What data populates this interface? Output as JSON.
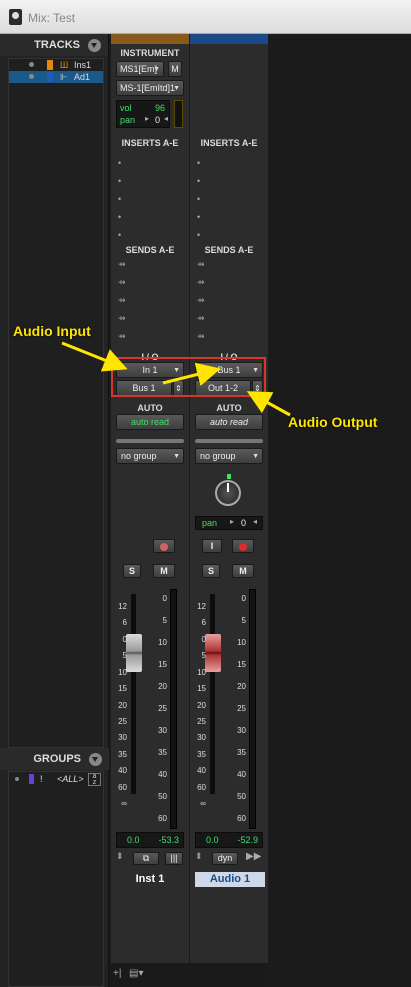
{
  "window": {
    "title": "Mix: Test"
  },
  "tracks_panel": {
    "header": "TRACKS",
    "items": [
      {
        "name": "Ins1",
        "type_icon": "instrument-track-icon",
        "color": "#e08a10"
      },
      {
        "name": "Ad1",
        "type_icon": "audio-track-icon",
        "color": "#1a5fb4",
        "selected": true
      }
    ]
  },
  "groups_panel": {
    "header": "GROUPS",
    "items": [
      {
        "flag": "!",
        "name": "<ALL>",
        "color": "#6b3fd6"
      }
    ],
    "sort_glyph": "az"
  },
  "strips": [
    {
      "name": "Inst 1",
      "color": "#8a5a1a",
      "instrument": {
        "header": "INSTRUMENT",
        "midi_in": "MS1[Em]",
        "mute": "M",
        "midi_out": "MS-1[EmItd]1",
        "vol_label": "vol",
        "vol_value": "96",
        "pan_label": "pan",
        "pan_value": "0"
      },
      "inserts_header": "INSERTS A-E",
      "sends_header": "SENDS A-E",
      "io_header": "I / O",
      "input": "In 1",
      "output": "Bus 1",
      "auto_header": "AUTO",
      "auto_mode": "auto read",
      "group": "no group",
      "solo": "S",
      "mute": "M",
      "fader_scale": [
        "12",
        "6",
        "0",
        "5",
        "10",
        "15",
        "20",
        "25",
        "30",
        "35",
        "40",
        "60",
        "∞"
      ],
      "meter_scale": [
        "0",
        "5",
        "10",
        "15",
        "20",
        "25",
        "30",
        "35",
        "40",
        "50",
        "60"
      ],
      "volume_readout": "0.0",
      "peak_readout": "-53.3"
    },
    {
      "name": "Audio 1",
      "color": "#1a4a8a",
      "inserts_header": "INSERTS A-E",
      "sends_header": "SENDS A-E",
      "io_header": "I / O",
      "input": "Bus 1",
      "output": "Out 1-2",
      "auto_header": "AUTO",
      "auto_mode": "auto read",
      "group": "no group",
      "pan_label": "pan",
      "pan_value": "0",
      "input_monitor": "I",
      "solo": "S",
      "mute": "M",
      "fader_scale": [
        "12",
        "6",
        "0",
        "5",
        "10",
        "15",
        "20",
        "25",
        "30",
        "35",
        "40",
        "60",
        "∞"
      ],
      "meter_scale": [
        "0",
        "5",
        "10",
        "15",
        "20",
        "25",
        "30",
        "35",
        "40",
        "50",
        "60"
      ],
      "volume_readout": "0.0",
      "peak_readout": "-52.9",
      "dyn_label": "dyn"
    }
  ],
  "annotations": {
    "audio_input": "Audio Input",
    "audio_output": "Audio Output",
    "highlight_color": "#d6362b",
    "arrow_color": "#ffe600"
  }
}
